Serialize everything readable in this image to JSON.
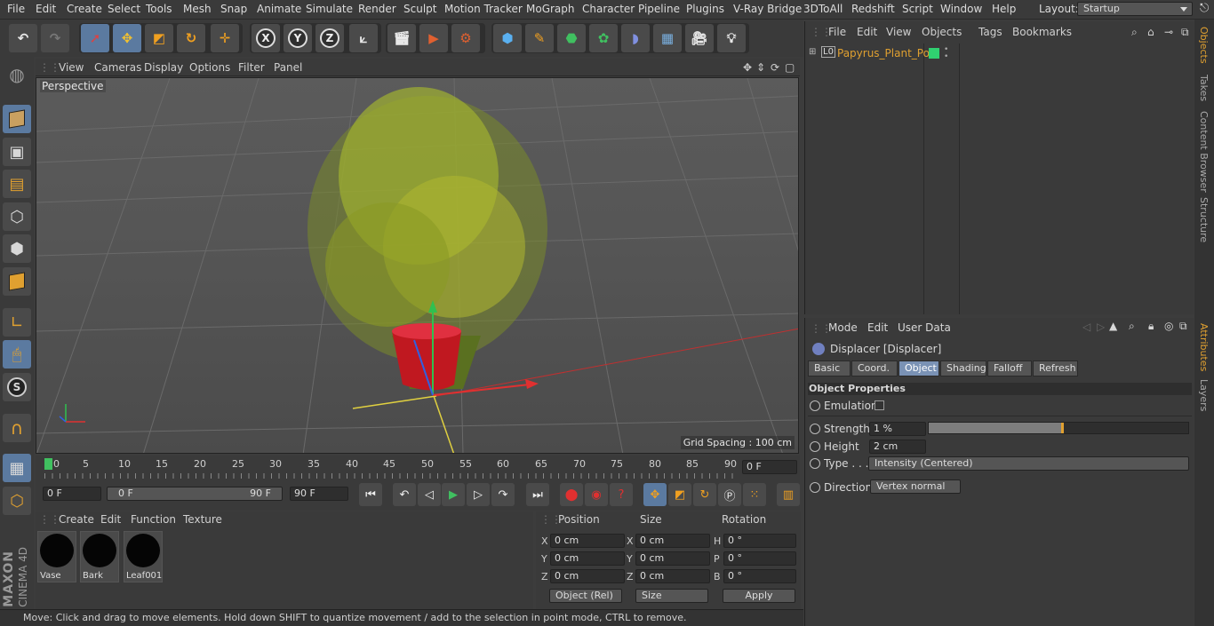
{
  "menubar": {
    "items": [
      "File",
      "Edit",
      "Create",
      "Select",
      "Tools",
      "Mesh",
      "Snap",
      "Animate",
      "Simulate",
      "Render",
      "Sculpt",
      "Motion Tracker",
      "MoGraph",
      "Character",
      "Pipeline",
      "Plugins",
      "V-Ray Bridge",
      "3DToAll",
      "Redshift",
      "Script",
      "Window",
      "Help"
    ],
    "layout_label": "Layout:",
    "layout_value": "Startup"
  },
  "toolbar": {
    "x": "X",
    "y": "Y",
    "z": "Z"
  },
  "viewport": {
    "menu": [
      "View",
      "Cameras",
      "Display",
      "Options",
      "Filter",
      "Panel"
    ],
    "label": "Perspective",
    "grid_spacing": "Grid Spacing : 100 cm"
  },
  "timeline": {
    "ticks": [
      "0",
      "5",
      "10",
      "15",
      "20",
      "25",
      "30",
      "35",
      "40",
      "45",
      "50",
      "55",
      "60",
      "65",
      "70",
      "75",
      "80",
      "85",
      "90"
    ],
    "current_frame": "0 F",
    "start": "0 F",
    "range_start": "0 F",
    "range_end": "90 F",
    "end": "90 F"
  },
  "materials": {
    "menu": [
      "Create",
      "Edit",
      "Function",
      "Texture"
    ],
    "items": [
      "Vase",
      "Bark",
      "Leaf001"
    ]
  },
  "coords": {
    "headers": [
      "Position",
      "Size",
      "Rotation"
    ],
    "pos": {
      "x": "0 cm",
      "y": "0 cm",
      "z": "0 cm"
    },
    "size": {
      "x": "0 cm",
      "y": "0 cm",
      "z": "0 cm"
    },
    "rot": {
      "h": "0 °",
      "p": "0 °",
      "b": "0 °"
    },
    "mode": "Object (Rel)",
    "size_mode": "Size",
    "apply": "Apply",
    "axes": {
      "x": "X",
      "y": "Y",
      "z": "Z",
      "h": "H",
      "p": "P",
      "b": "B"
    }
  },
  "status": "Move: Click and drag to move elements. Hold down SHIFT to quantize movement / add to the selection in point mode, CTRL to remove.",
  "objects": {
    "menu": [
      "File",
      "Edit",
      "View",
      "Objects",
      "Tags",
      "Bookmarks"
    ],
    "object_name": "Papyrus_Plant_Pot",
    "layer_badge": "L0"
  },
  "attributes": {
    "menu": [
      "Mode",
      "Edit",
      "User Data"
    ],
    "title": "Displacer [Displacer]",
    "tabs": [
      "Basic",
      "Coord.",
      "Object",
      "Shading",
      "Falloff",
      "Refresh"
    ],
    "active_tab": "Object",
    "section": "Object Properties",
    "emulation_label": "Emulation",
    "strength_label": "Strength",
    "strength_value": "1 %",
    "strength_fraction": 0.01,
    "height_label": "Height",
    "height_value": "2 cm",
    "type_label": "Type . . .",
    "type_value": "Intensity (Centered)",
    "direction_label": "Direction",
    "direction_value": "Vertex normal"
  },
  "sidetabs": [
    "Objects",
    "Takes",
    "Content Browser",
    "Structure"
  ],
  "sidetabs_attr": [
    "Attributes",
    "Layers"
  ],
  "branding": {
    "brand": "MAXON",
    "product": "CINEMA 4D"
  }
}
